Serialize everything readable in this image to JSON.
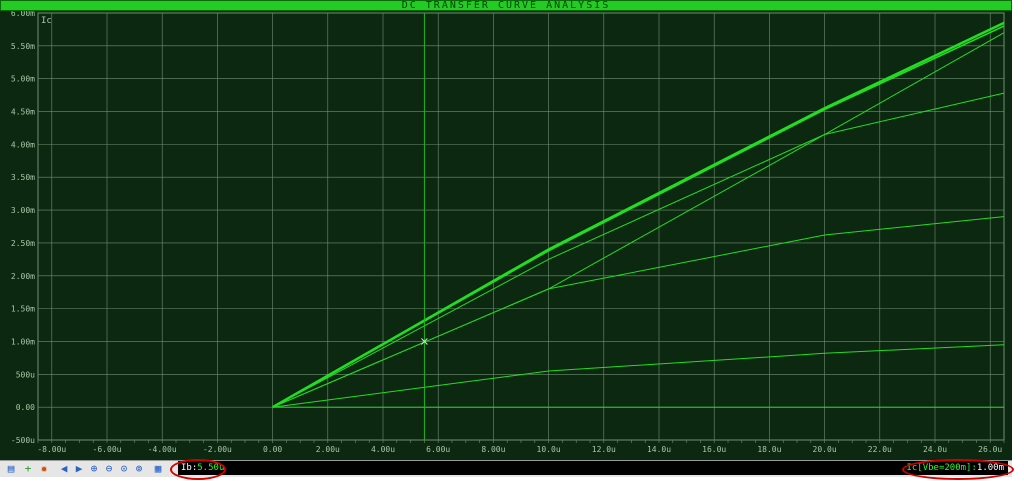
{
  "window": {
    "title": "DC TRANSFER CURVE ANALYSIS"
  },
  "colors": {
    "background": "#0d2810",
    "grid": "#6f8f6f",
    "axis_text": "#a6c9a6",
    "trace": "#22dd22",
    "title_bar": "#22cc22",
    "readout": "#22ff22",
    "highlight": "#d40000"
  },
  "chart_data": {
    "type": "line",
    "title": "DC TRANSFER CURVE ANALYSIS",
    "ylabel": "Ic",
    "xlabel": "",
    "xlim": [
      -8.5,
      26.5
    ],
    "ylim": [
      -0.5,
      6.0
    ],
    "x_tick_values": [
      -8,
      -6,
      -4,
      -2,
      0,
      2,
      4,
      6,
      8,
      10,
      12,
      14,
      16,
      18,
      20,
      22,
      24,
      26
    ],
    "x_tick_labels": [
      "-8.00u",
      "-6.00u",
      "-4.00u",
      "-2.00u",
      "0.00",
      "2.00u",
      "4.00u",
      "6.00u",
      "8.00u",
      "10.0u",
      "12.0u",
      "14.0u",
      "16.0u",
      "18.0u",
      "20.0u",
      "22.0u",
      "24.0u",
      "26.0u"
    ],
    "y_tick_values": [
      -0.5,
      0,
      0.5,
      1.0,
      1.5,
      2.0,
      2.5,
      3.0,
      3.5,
      4.0,
      4.5,
      5.0,
      5.5,
      6.0
    ],
    "y_tick_labels": [
      "-500u",
      "0.00",
      "500u",
      "1.00m",
      "1.50m",
      "2.00m",
      "2.50m",
      "3.00m",
      "3.50m",
      "4.00m",
      "4.50m",
      "5.00m",
      "5.50m",
      "6.00m"
    ],
    "grid": true,
    "cursor": {
      "x": 5.5,
      "y": 1.0
    },
    "series": [
      {
        "x": [
          0,
          10,
          20,
          26.5
        ],
        "y": [
          0,
          2.4,
          4.55,
          5.85
        ],
        "width": 2.5
      },
      {
        "x": [
          0,
          10,
          20,
          26.5
        ],
        "y": [
          0,
          2.38,
          4.53,
          5.8
        ],
        "width": 1.5
      },
      {
        "x": [
          0,
          10,
          20,
          26.5
        ],
        "y": [
          0,
          2.25,
          4.15,
          5.7
        ],
        "width": 1
      },
      {
        "x": [
          0,
          10,
          20,
          26.5
        ],
        "y": [
          0,
          1.8,
          4.15,
          4.78
        ],
        "width": 1
      },
      {
        "x": [
          0,
          10,
          20,
          26.5
        ],
        "y": [
          0,
          1.8,
          2.62,
          2.9
        ],
        "width": 1
      },
      {
        "x": [
          0,
          10,
          20,
          26.5
        ],
        "y": [
          0,
          0.55,
          0.82,
          0.95
        ],
        "width": 1
      },
      {
        "x": [
          0,
          26.5
        ],
        "y": [
          0,
          0
        ],
        "width": 1
      }
    ]
  },
  "toolbar": {
    "buttons": [
      "graph-edit-icon",
      "add-trace-icon",
      "simulate-icon",
      "arrow-left-icon",
      "arrow-right-icon",
      "zoom-in-icon",
      "zoom-out-icon",
      "zoom-all-icon",
      "zoom-area-icon",
      "graph-properties-icon"
    ]
  },
  "readouts": {
    "left_label": "Ib:",
    "left_value": "5.50u",
    "right_label": "Ic[Vbe=200m]:",
    "right_value": "1.00m"
  }
}
